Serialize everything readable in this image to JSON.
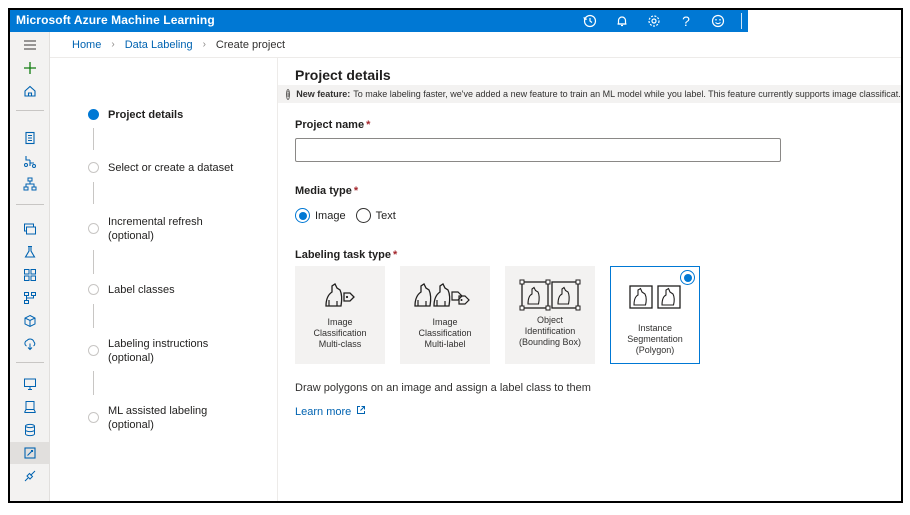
{
  "app": {
    "title": "Microsoft Azure Machine Learning"
  },
  "topbar_icons": [
    "history-icon",
    "bell-icon",
    "gear-icon",
    "help-icon",
    "smiley-icon"
  ],
  "breadcrumb": {
    "home": "Home",
    "section": "Data Labeling",
    "current": "Create project"
  },
  "steps": [
    {
      "label": "Project details",
      "active": true
    },
    {
      "label": "Select or create a dataset",
      "active": false
    },
    {
      "label": "Incremental refresh",
      "sublabel": "(optional)",
      "active": false
    },
    {
      "label": "Label classes",
      "active": false
    },
    {
      "label": "Labeling instructions",
      "sublabel": "(optional)",
      "active": false
    },
    {
      "label": "ML assisted labeling",
      "sublabel": "(optional)",
      "active": false
    }
  ],
  "main": {
    "title": "Project details",
    "info": {
      "strong": "New feature:",
      "text": "To make labeling faster, we've added a new feature to train an ML model while you label. This feature currently supports image classificat..."
    },
    "project_name": {
      "label": "Project name",
      "required": "*",
      "value": "",
      "placeholder": ""
    },
    "media_type": {
      "label": "Media type",
      "required": "*",
      "options": [
        {
          "label": "Image",
          "checked": true
        },
        {
          "label": "Text",
          "checked": false
        }
      ]
    },
    "task_type": {
      "label": "Labeling task type",
      "required": "*",
      "tiles": [
        {
          "line1": "Image",
          "line2": "Classification",
          "line3": "Multi-class",
          "selected": false
        },
        {
          "line1": "Image",
          "line2": "Classification",
          "line3": "Multi-label",
          "selected": false
        },
        {
          "line1": "Object",
          "line2": "Identification",
          "line3": "(Bounding Box)",
          "selected": false
        },
        {
          "line1": "Instance",
          "line2": "Segmentation",
          "line3": "(Polygon)",
          "selected": true
        }
      ]
    },
    "description": "Draw polygons on an image and assign a label class to them",
    "learn_more": "Learn more"
  },
  "colors": {
    "accent": "#0078d4",
    "link": "#0063b1",
    "required": "#a4262c"
  }
}
